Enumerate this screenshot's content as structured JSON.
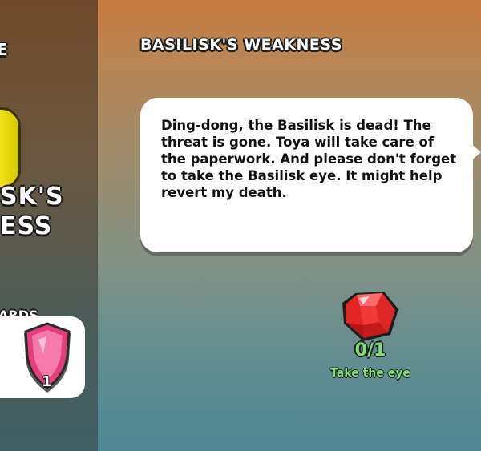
{
  "left_panel": {
    "top_fragment": "E",
    "title_line1": "SK'S",
    "title_line2": "ESS",
    "rewards_label": "ARDS",
    "reward_count": "1"
  },
  "quest": {
    "title": "BASILISK'S WEAKNESS",
    "dialogue": "Ding-dong, the Basilisk is dead! The threat is gone. Toya will take care of the paperwork. And please don't forget to take the Basilisk eye. It might help revert my death."
  },
  "objective": {
    "progress": "0/1",
    "label": "Take the eye",
    "icon": "red-gem-icon"
  },
  "colors": {
    "objective_green": "#7fe07a",
    "reward_shield": "#e0407a"
  }
}
